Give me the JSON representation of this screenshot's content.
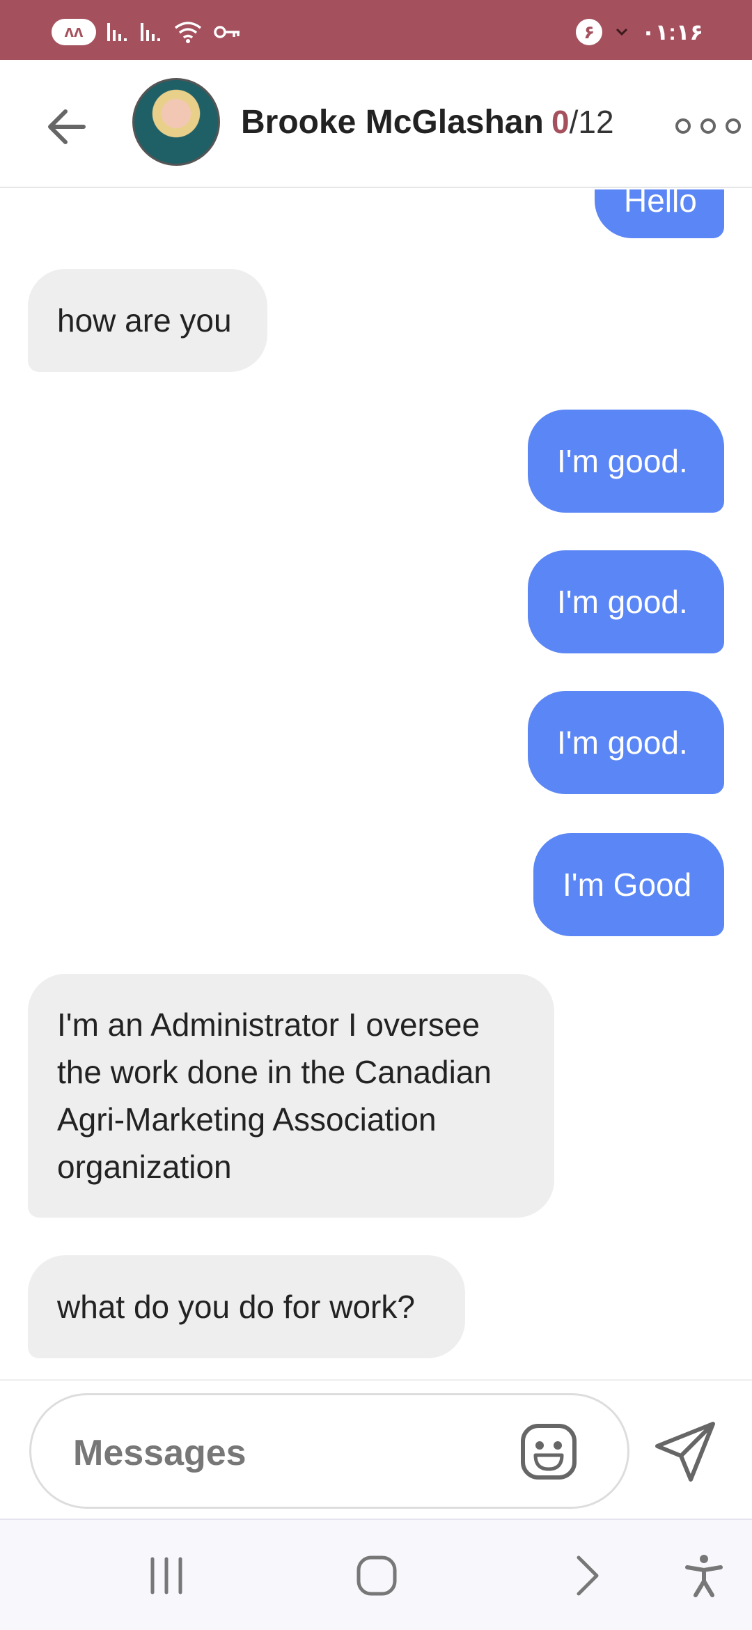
{
  "status_bar": {
    "app_badge": "ᴧᴧ",
    "notification_count": "۶",
    "time": "۰۱:۱۶",
    "background": "#a5505d"
  },
  "header": {
    "back_icon": "arrow-left-icon",
    "contact_name": "Brooke McGlashan",
    "counter_current": "0",
    "counter_total": "/12",
    "more_icon": "more-dots-icon"
  },
  "messages": [
    {
      "direction": "out",
      "text": "Hello"
    },
    {
      "direction": "in",
      "text": "how are you"
    },
    {
      "direction": "out",
      "text": "I'm good."
    },
    {
      "direction": "out",
      "text": "I'm good."
    },
    {
      "direction": "out",
      "text": "I'm good."
    },
    {
      "direction": "out",
      "text": "I'm Good"
    },
    {
      "direction": "in",
      "text": "I'm an Administrator I oversee the work done in the Canadian Agri-Marketing Association  organization"
    },
    {
      "direction": "in",
      "text": "what do you do for work?"
    }
  ],
  "composer": {
    "placeholder": "Messages",
    "emoji_icon": "emoji-icon",
    "send_icon": "send-icon"
  },
  "colors": {
    "accent": "#a5505d",
    "outgoing_bubble": "#5b86f5",
    "incoming_bubble": "#eeeeee"
  },
  "nav_bar": {
    "items": [
      "recent-apps-icon",
      "home-icon",
      "back-chevron-icon",
      "accessibility-icon"
    ]
  }
}
